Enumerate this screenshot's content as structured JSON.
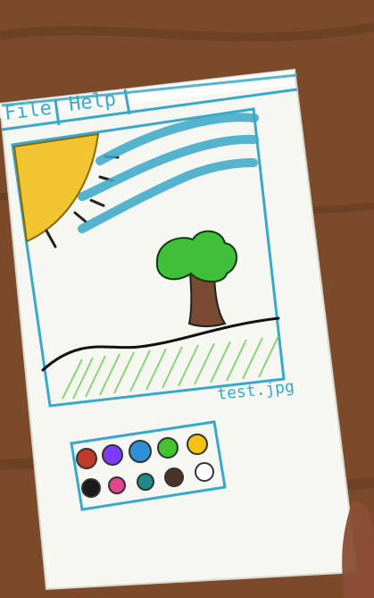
{
  "menu": {
    "items": [
      {
        "label": "File"
      },
      {
        "label": "Help"
      }
    ]
  },
  "canvas": {
    "filename": "test.jpg"
  },
  "palette": {
    "colors": [
      {
        "name": "red",
        "hex": "#c0392b"
      },
      {
        "name": "purple",
        "hex": "#7d3cff"
      },
      {
        "name": "blue",
        "hex": "#2f8fd6"
      },
      {
        "name": "green",
        "hex": "#45c230"
      },
      {
        "name": "yellow",
        "hex": "#f1c40f"
      },
      {
        "name": "black",
        "hex": "#1a1a1a"
      },
      {
        "name": "pink",
        "hex": "#e0458e"
      },
      {
        "name": "teal",
        "hex": "#1f8a8a"
      },
      {
        "name": "dark-brown",
        "hex": "#4a3428"
      },
      {
        "name": "white",
        "hex": "#ffffff"
      }
    ]
  },
  "colors": {
    "wood": "#7a4a2a",
    "paper": "#f7f7f2",
    "marker_blue": "#3aa8c8",
    "sun_yellow": "#f2c431",
    "grass_green": "#7ccf6b",
    "tree_green": "#3fbf3a",
    "trunk_brown": "#7b4a33"
  },
  "icons": {
    "sun": "sun-icon",
    "tree": "tree-icon"
  }
}
